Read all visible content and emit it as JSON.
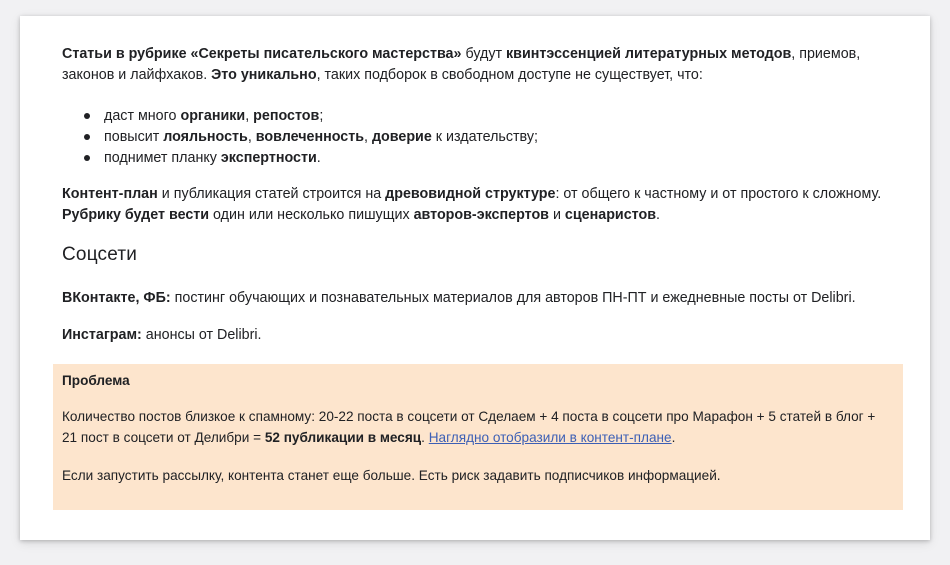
{
  "intro": {
    "b1": "Статьи в рубрике «Секреты писательского мастерства»",
    "t1": " будут ",
    "b2": "квинтэссенцией литературных методов",
    "t2": ", приемов, законов и лайфхаков. ",
    "b3": "Это уникально",
    "t3": ", таких подборок в свободном доступе не существует, что:"
  },
  "bullets": [
    {
      "t1": "даст много ",
      "b1": "органики",
      "t2": ", ",
      "b2": "репостов",
      "t3": ";"
    },
    {
      "t1": "повысит ",
      "b1": "лояльность",
      "t2": ", ",
      "b2": "вовлеченность",
      "t3": ", ",
      "b3": "доверие",
      "t4": " к издательству;"
    },
    {
      "t1": "поднимет планку ",
      "b1": "экспертности",
      "t2": "."
    }
  ],
  "plan": {
    "b1": "Контент-план",
    "t1": " и публикация статей строится на ",
    "b2": "древовидной структуре",
    "t2": ": от общего к частному и от простого к сложному. ",
    "b3": "Рубрику будет вести",
    "t3": " один или несколько пишущих ",
    "b4": "авторов-экспертов",
    "t4": " и ",
    "b5": "сценаристов",
    "t5": "."
  },
  "section_title": "Соцсети",
  "vk": {
    "label": "ВКонтакте, ФБ:",
    "text": " постинг обучающих и познавательных материалов для авторов ПН-ПТ и ежедневные посты от Delibri."
  },
  "insta": {
    "label": "Инстаграм:",
    "text": " анонсы от Delibri."
  },
  "problem": {
    "title": "Проблема",
    "t1": "Количество постов близкое к спамному: 20-22 поста в соцсети от Сделаем + 4 поста в соцсети про Марафон + 5 статей в блог + 21 пост в соцсети от Делибри = ",
    "b1": "52 публикации в месяц",
    "t2": ". ",
    "link": "Наглядно отобразили в контент-плане",
    "t3": ".",
    "body2": "Если запустить рассылку, контента станет еще больше. Есть риск задавить подписчиков информацией."
  },
  "colors": {
    "problem_bg": "#fde5cd",
    "link": "#3c5fb5",
    "text": "#202124"
  }
}
